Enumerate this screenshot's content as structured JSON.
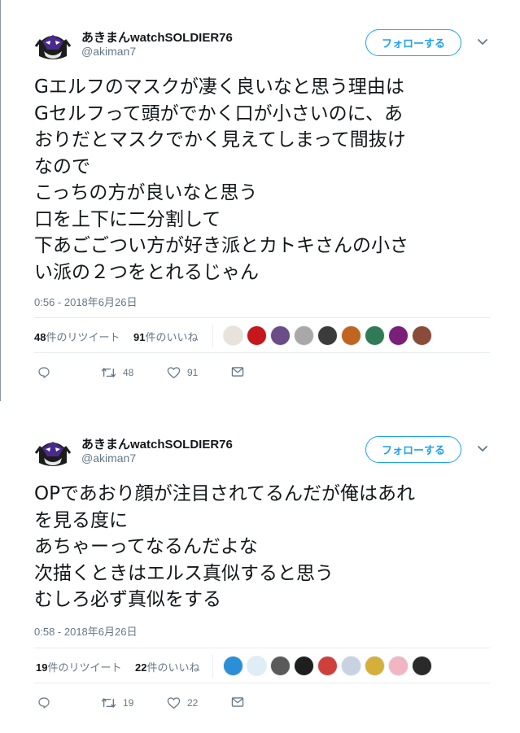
{
  "tweets": [
    {
      "author": {
        "name": "あきまんwatchSOLDIER76",
        "handle": "@akiman7"
      },
      "follow_label": "フォローする",
      "text_lines": [
        "Gエルフのマスクが凄く良いなと思う理由は",
        "Gセルフって頭がでかく口が小さいのに、あ",
        "おりだとマスクでかく見えてしまって間抜け",
        "なので",
        "こっちの方が良いなと思う",
        "口を上下に二分割して",
        "下あごごつい方が好き派とカトキさんの小さ",
        "い派の２つをとれるじゃん"
      ],
      "timestamp": "0:56 - 2018年6月26日",
      "retweets_count": "48",
      "retweets_label": "件のリツイート",
      "likes_count": "91",
      "likes_label": "件のいいね",
      "reply_count": "",
      "action_retweets": "48",
      "action_likes": "91",
      "liker_colors": [
        "#e8e2da",
        "#c8161d",
        "#6b4c86",
        "#a8a8a8",
        "#3b3b3b",
        "#c0651e",
        "#2f7b58",
        "#7a1f7a",
        "#8a4b3a"
      ]
    },
    {
      "author": {
        "name": "あきまんwatchSOLDIER76",
        "handle": "@akiman7"
      },
      "follow_label": "フォローする",
      "text_lines": [
        "OPであおり顔が注目されてるんだが俺はあれ",
        "を見る度に",
        "あちゃーってなるんだよな",
        "次描くときはエルス真似すると思う",
        "むしろ必ず真似をする"
      ],
      "timestamp": "0:58 - 2018年6月26日",
      "retweets_count": "19",
      "retweets_label": "件のリツイート",
      "likes_count": "22",
      "likes_label": "件のいいね",
      "reply_count": "",
      "action_retweets": "19",
      "action_likes": "22",
      "liker_colors": [
        "#2a8fd6",
        "#dfeef5",
        "#5a5a5a",
        "#1e1e1e",
        "#d0403a",
        "#c9d2e0",
        "#d4b03a",
        "#f1b5c4",
        "#2a2a2a"
      ]
    }
  ],
  "icons": {
    "reply": "reply-icon",
    "retweet": "retweet-icon",
    "like": "heart-icon",
    "dm": "envelope-icon",
    "menu": "chevron-down-icon"
  },
  "colors": {
    "accent": "#1da1f2",
    "text": "#14171a",
    "muted": "#657786",
    "border": "#e6ecf0"
  }
}
